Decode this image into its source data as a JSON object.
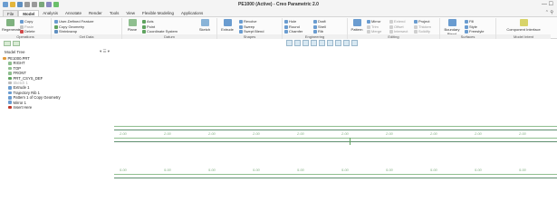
{
  "window": {
    "title": "PE1000 (Active) - Creo Parametric 2.0"
  },
  "tabs": [
    {
      "label": "File",
      "key": "file"
    },
    {
      "label": "Model",
      "key": "model"
    },
    {
      "label": "Analysis",
      "key": "analysis"
    },
    {
      "label": "Annotate",
      "key": "annotate"
    },
    {
      "label": "Render",
      "key": "render"
    },
    {
      "label": "Tools",
      "key": "tools"
    },
    {
      "label": "View",
      "key": "view"
    },
    {
      "label": "Flexible Modeling",
      "key": "flex"
    },
    {
      "label": "Applications",
      "key": "apps"
    }
  ],
  "ribbon": {
    "regenerate": "Regenerate",
    "copy": "Copy",
    "paste": "Paste",
    "delete": "Delete",
    "user_defined_feature": "User-Defined Feature",
    "copy_geometry": "Copy Geometry",
    "shrinkwrap": "Shrinkwrap",
    "plane": "Plane",
    "axis": "Axis",
    "point": "Point",
    "coordinate_system": "Coordinate System",
    "sketch": "Sketch",
    "extrude": "Extrude",
    "revolve": "Revolve",
    "sweep": "Sweep",
    "swept_blend": "Swept Blend",
    "hole": "Hole",
    "round": "Round",
    "chamfer": "Chamfer",
    "draft": "Draft",
    "shell": "Shell",
    "rib": "Rib",
    "pattern": "Pattern",
    "mirror": "Mirror",
    "trim": "Trim",
    "merge": "Merge",
    "extend": "Extend",
    "offset": "Offset",
    "intersect": "Intersect",
    "project": "Project",
    "thicken": "Thicken",
    "solidify": "Solidify",
    "boundary_blend": "Boundary Blend",
    "fill": "Fill",
    "style": "Style",
    "freestyle": "Freestyle",
    "component_interface": "Component Interface",
    "groups": {
      "operations": "Operations",
      "get_data": "Get Data",
      "datum": "Datum",
      "shapes": "Shapes",
      "engineering": "Engineering",
      "editing": "Editing",
      "surfaces": "Surfaces",
      "model_intent": "Model Intent"
    }
  },
  "model_tree": {
    "title": "Model Tree",
    "items": [
      {
        "label": "PE1000.PRT",
        "icon": "part-icon",
        "indent": 0,
        "dim": false
      },
      {
        "label": "RIGHT",
        "icon": "datum-plane-icon",
        "indent": 1,
        "dim": false
      },
      {
        "label": "TOP",
        "icon": "datum-plane-icon",
        "indent": 1,
        "dim": false
      },
      {
        "label": "FRONT",
        "icon": "datum-plane-icon",
        "indent": 1,
        "dim": false
      },
      {
        "label": "PRT_CSYS_DEF",
        "icon": "csys-icon",
        "indent": 1,
        "dim": false
      },
      {
        "label": "Sketch 1",
        "icon": "sketch-icon",
        "indent": 1,
        "dim": true
      },
      {
        "label": "Extrude 1",
        "icon": "extrude-icon",
        "indent": 1,
        "dim": false
      },
      {
        "label": "Trajectory Rib 1",
        "icon": "rib-icon",
        "indent": 1,
        "dim": false
      },
      {
        "label": "Pattern 1 of Copy Geometry",
        "icon": "pattern-icon",
        "indent": 1,
        "dim": false
      },
      {
        "label": "Mirror 1",
        "icon": "mirror-icon",
        "indent": 1,
        "dim": false
      },
      {
        "label": "Insert Here",
        "icon": "insert-here-icon",
        "indent": 1,
        "dim": false
      }
    ]
  },
  "graphics": {
    "band1_labels": [
      "2.00",
      "2.00",
      "2.00",
      "2.00",
      "2.00",
      "2.00",
      "2.00",
      "2.00",
      "2.00",
      "2.00"
    ],
    "band2_labels": [
      "5.00",
      "5.00",
      "5.00",
      "5.00",
      "5.00",
      "5.00",
      "5.00",
      "5.00",
      "5.00",
      "5.00"
    ]
  },
  "colors": {
    "accent_green": "#8fbf8f",
    "datum_green": "#5fa35f",
    "icon_blue": "#6a9cd0",
    "icon_orange": "#e39a3b"
  }
}
